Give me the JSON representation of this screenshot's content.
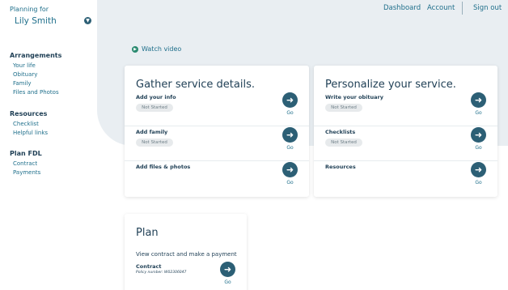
{
  "sidebar": {
    "planning_label": "Planning for",
    "person_name": "Lily Smith",
    "sections": [
      {
        "title": "Arrangements",
        "items": [
          "Your life",
          "Obituary",
          "Family",
          "Files and Photos"
        ]
      },
      {
        "title": "Resources",
        "items": [
          "Checklist",
          "Helpful links"
        ]
      },
      {
        "title": "Plan FDL",
        "items": [
          "Contract",
          "Payments"
        ]
      }
    ]
  },
  "topnav": {
    "dashboard": "Dashboard",
    "account": "Account",
    "sign_out": "Sign out"
  },
  "watch_video": "Watch video",
  "cards": {
    "gather": {
      "title": "Gather service details.",
      "rows": [
        {
          "label": "Add your info",
          "status": "Not Started",
          "go": "Go"
        },
        {
          "label": "Add family",
          "status": "Not Started",
          "go": "Go"
        },
        {
          "label": "Add files & photos",
          "go": "Go"
        }
      ]
    },
    "personalize": {
      "title": "Personalize your service.",
      "rows": [
        {
          "label": "Write your obituary",
          "status": "Not Started",
          "go": "Go"
        },
        {
          "label": "Checklists",
          "status": "Not Started",
          "go": "Go"
        },
        {
          "label": "Resources",
          "go": "Go"
        }
      ]
    },
    "plan": {
      "title": "Plan",
      "subtitle": "View contract and make a payment",
      "row": {
        "label": "Contract",
        "policy": "Policy number: W02306047",
        "go": "Go"
      }
    }
  },
  "colors": {
    "accent": "#2c5f75",
    "link": "#1f6f8b",
    "background_panel": "#e9eef2",
    "badge": "#e7eaec",
    "play": "#2a8a70"
  },
  "icons": {
    "person_toggle": "chevron-down-icon",
    "go": "arrow-right-icon",
    "watch": "play-icon"
  }
}
